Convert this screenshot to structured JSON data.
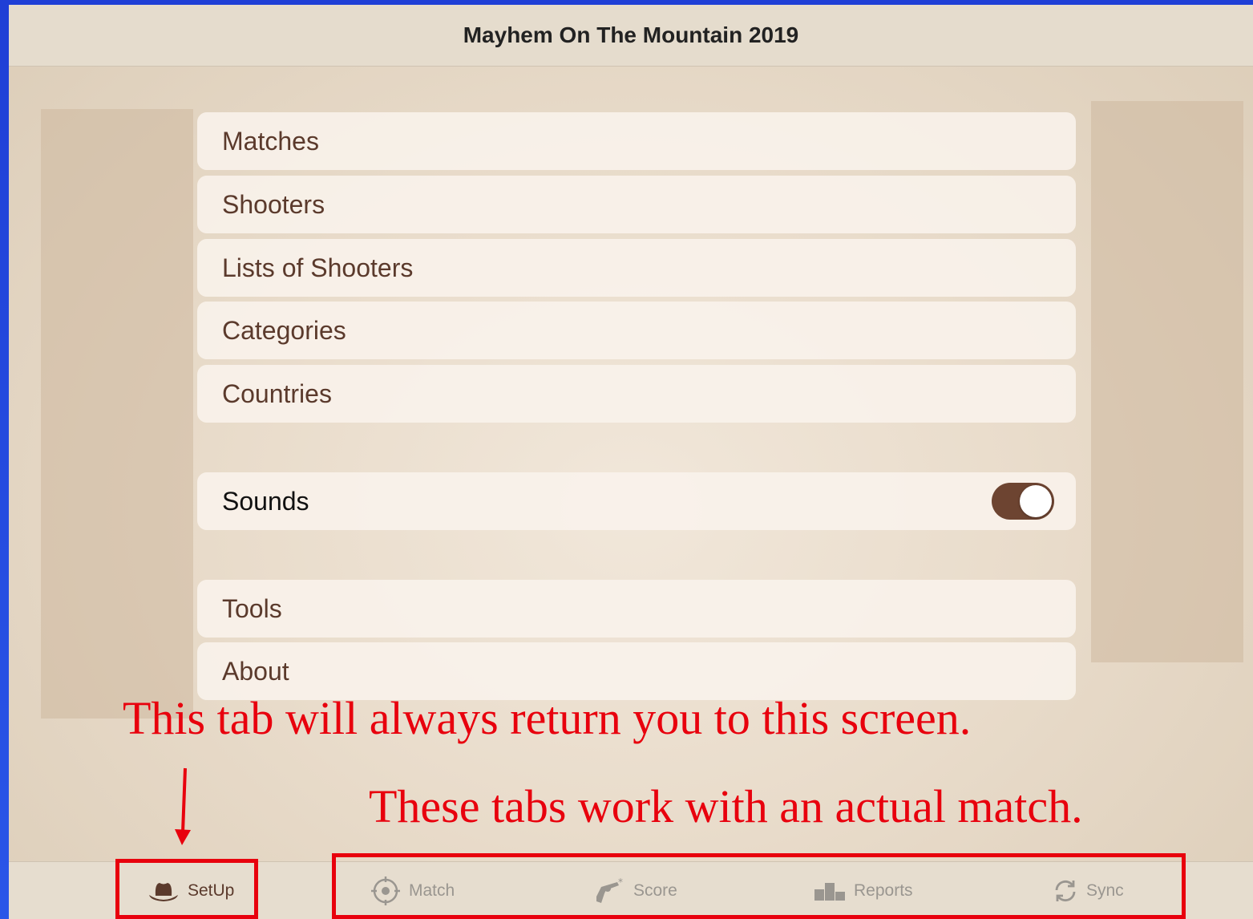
{
  "header": {
    "title": "Mayhem On The Mountain 2019"
  },
  "menu": {
    "items": [
      {
        "label": "Matches"
      },
      {
        "label": "Shooters"
      },
      {
        "label": "Lists of Shooters"
      },
      {
        "label": "Categories"
      },
      {
        "label": "Countries"
      }
    ],
    "sounds": {
      "label": "Sounds",
      "enabled": true
    },
    "extra": [
      {
        "label": "Tools"
      },
      {
        "label": "About"
      }
    ]
  },
  "annotations": {
    "setup_note": "This tab will always return you to this screen.",
    "match_note": "These tabs work with an actual match."
  },
  "tabs": [
    {
      "label": "SetUp",
      "icon": "cowboy-hat-icon",
      "active": true
    },
    {
      "label": "Match",
      "icon": "crosshair-icon",
      "active": false
    },
    {
      "label": "Score",
      "icon": "revolver-icon",
      "active": false
    },
    {
      "label": "Reports",
      "icon": "podium-icon",
      "active": false
    },
    {
      "label": "Sync",
      "icon": "sync-icon",
      "active": false
    }
  ],
  "colors": {
    "accent": "#6d4431",
    "annotation": "#e8000d",
    "background_frame": "#2a56e8"
  }
}
